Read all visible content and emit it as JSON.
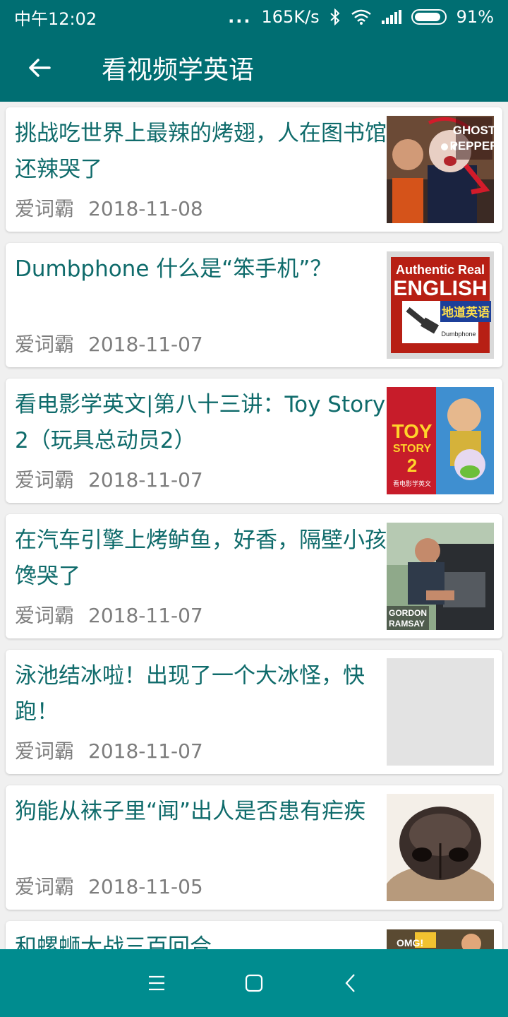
{
  "status_bar": {
    "time": "中午12:02",
    "dots": "...",
    "network_speed": "165K/s",
    "battery_percent": "91%",
    "battery_level": 0.91
  },
  "app_bar": {
    "title": "看视频学英语",
    "back_icon": "back-arrow-icon"
  },
  "articles": [
    {
      "title": "挑战吃世界上最辣的烤翅，人在图书馆还辣哭了",
      "source": "爱词霸",
      "date": "2018-11-08",
      "thumb_text": [
        "GHOST",
        "PEPPER"
      ]
    },
    {
      "title": "Dumbphone 什么是“笨手机”？",
      "source": "爱词霸",
      "date": "2018-11-07",
      "thumb_text": [
        "Authentic Real",
        "ENGLISH",
        "地道英语",
        "Dumbphone"
      ]
    },
    {
      "title": "看电影学英文|第八十三讲：Toy Story 2（玩具总动员2）",
      "source": "爱词霸",
      "date": "2018-11-07",
      "thumb_text": [
        "TOY",
        "STORY",
        "2",
        "看电影学英文"
      ]
    },
    {
      "title": "在汽车引擎上烤鲈鱼，好香，隔壁小孩馋哭了",
      "source": "爱词霸",
      "date": "2018-11-07",
      "thumb_text": [
        "GORDON",
        "RAMSAY"
      ]
    },
    {
      "title": "泳池结冰啦！出现了一个大冰怪，快跑！",
      "source": "爱词霸",
      "date": "2018-11-07",
      "thumb_text": []
    },
    {
      "title": "狗能从袜子里“闻”出人是否患有疟疾",
      "source": "爱词霸",
      "date": "2018-11-05",
      "thumb_text": []
    },
    {
      "title": "和螺蛳大战三百回合",
      "source": "",
      "date": "",
      "thumb_text": [
        "OMG!"
      ]
    }
  ],
  "nav_bar": {
    "menu_icon": "menu-icon",
    "home_icon": "home-square-icon",
    "back_icon": "back-chevron-icon"
  },
  "colors": {
    "primary": "#006e72",
    "nav": "#008c8f",
    "title_text": "#0f6b6b",
    "meta_text": "#7d7d7d"
  }
}
